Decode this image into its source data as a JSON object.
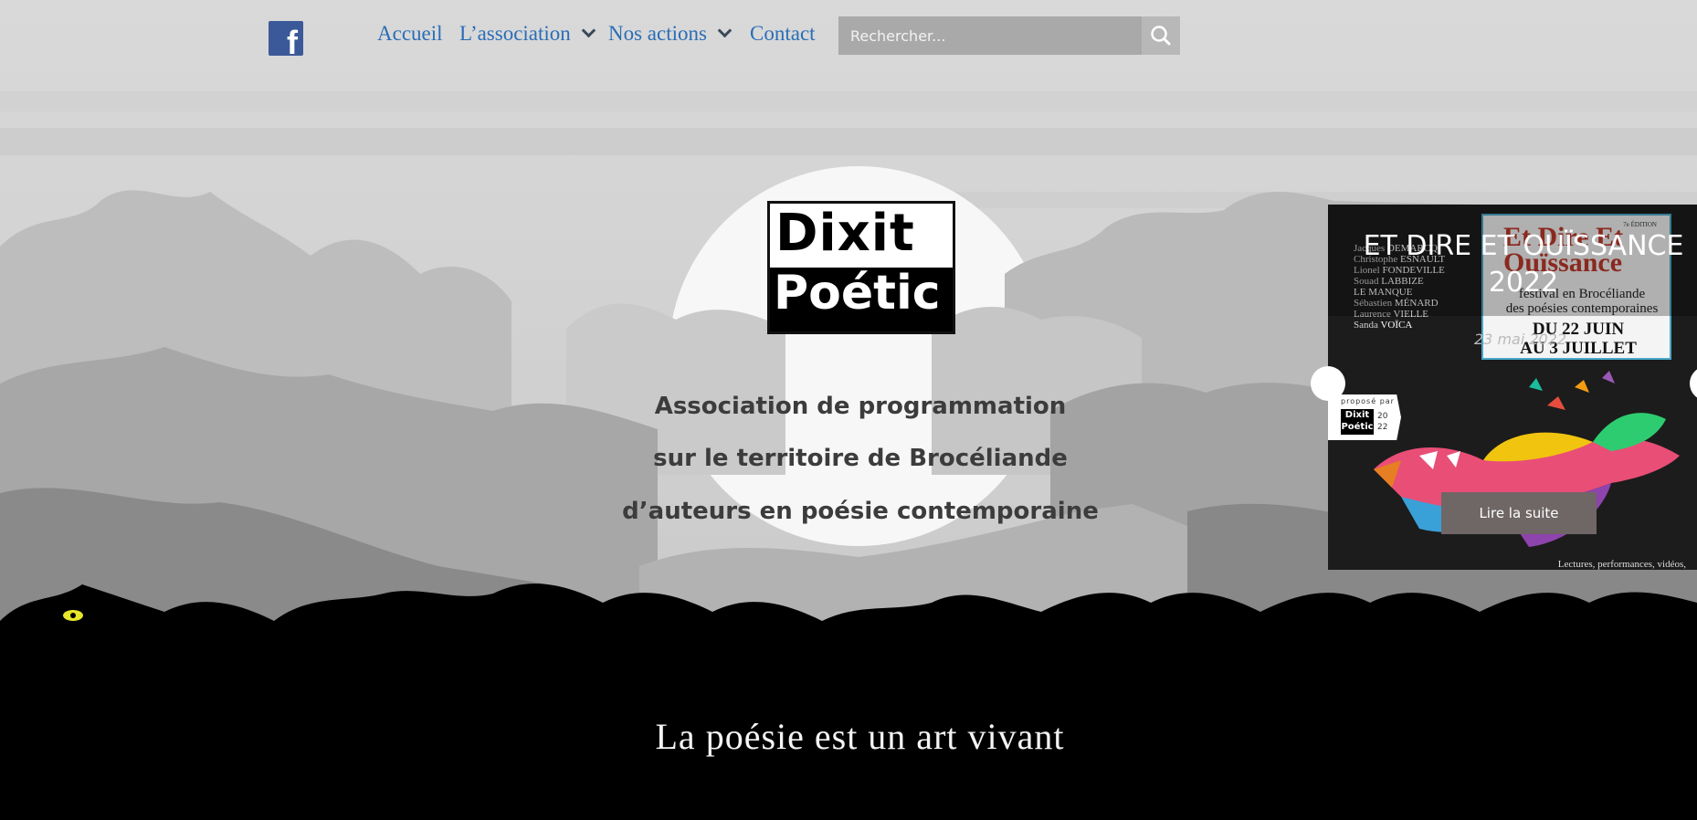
{
  "nav": {
    "facebook_icon": "facebook-icon",
    "items": [
      {
        "label": "Accueil",
        "has_dropdown": false
      },
      {
        "label": "L’association",
        "has_dropdown": true
      },
      {
        "label": "Nos actions",
        "has_dropdown": true
      },
      {
        "label": "Contact",
        "has_dropdown": false
      }
    ],
    "search": {
      "placeholder": "Rechercher...",
      "value": "",
      "icon": "search-icon"
    }
  },
  "hero": {
    "logo": {
      "line1": "Dixit",
      "line2": "Poétic"
    },
    "tagline": [
      "Association de programmation",
      "sur le territoire de Brocéliande",
      "d’auteurs en poésie contemporaine"
    ],
    "slogan": "La poésie est un art vivant"
  },
  "slider": {
    "title_line1": "ET DIRE ET OUÏSSANCE",
    "title_line2": "2022",
    "date": "23 mai 2022",
    "read_more": "Lire la suite",
    "poster": {
      "edition": "7e ÉDITION",
      "title_line1": "Et Dire Et",
      "title_line2": "Ouïssance",
      "subtitle_line1": "festival en Brocéliande",
      "subtitle_line2": "des poésies contemporaines",
      "date_from": "DU 22 JUIN",
      "date_to": "AU 3 JUILLET",
      "proposed_by": "proposé par",
      "proposed_logo_line1": "Dixit",
      "proposed_logo_line2": "Poétic",
      "proposed_year_line1": "20",
      "proposed_year_line2": "22",
      "footer": "Lectures, performances, vidéos,",
      "authors": [
        {
          "first": "Jacques",
          "last": "DEMARCQ"
        },
        {
          "first": "Christophe",
          "last": "ESNAULT"
        },
        {
          "first": "Lionel",
          "last": "FONDEVILLE"
        },
        {
          "first": "Souad",
          "last": "LABBIZE"
        },
        {
          "first": "",
          "last": "LE MANQUE"
        },
        {
          "first": "Sébastien",
          "last": "MÉNARD"
        },
        {
          "first": "Laurence",
          "last": "VIELLE"
        },
        {
          "first": "Sanda",
          "last": "VOÏCA"
        }
      ]
    }
  },
  "colors": {
    "nav_link": "#2a6db5",
    "facebook": "#3b5998",
    "search_bg": "#a9a9a9",
    "tagline": "#3c3c3c",
    "read_more_bg": "#6f6666"
  }
}
